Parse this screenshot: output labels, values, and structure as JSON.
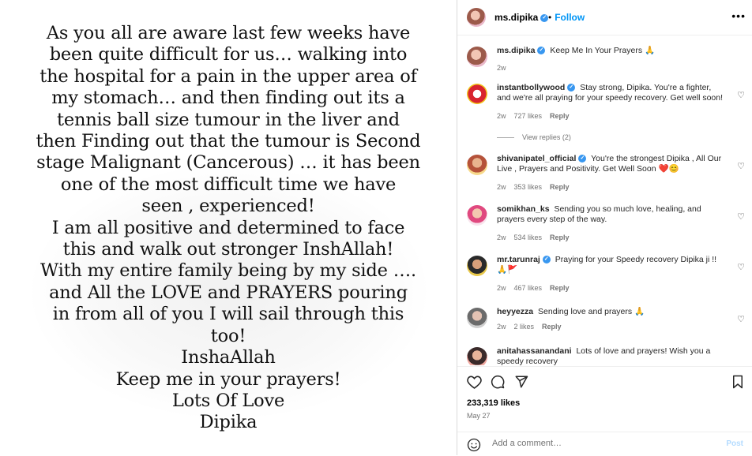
{
  "post": {
    "image_text": "As you all are aware last few weeks have\nbeen quite difficult for us… walking into\nthe hospital for a pain in the upper area of\nmy stomach… and then finding out its a\ntennis ball size tumour in the liver and\nthen Finding out that the tumour is Second\nstage Malignant (Cancerous) … it has been\none of the most difficult time we have\nseen , experienced!\nI am all positive and determined to face\nthis and walk out stronger InshAllah!\nWith my entire family being by my side ….\nand All the LOVE and PRAYERS pouring\nin from all of you I will sail through this\ntoo!\nInshaAllah\nKeep me in your prayers!\nLots Of Love\nDipika"
  },
  "header": {
    "username": "ms.dipika",
    "follow_label": "Follow",
    "separator": "•",
    "more_icon": "more-horizontal-icon"
  },
  "caption": {
    "username": "ms.dipika",
    "text": "Keep Me In Your Prayers 🙏",
    "time": "2w"
  },
  "comments": [
    {
      "username": "instantbollywood",
      "text": "Stay strong, Dipika. You're a fighter, and we're all praying for your speedy recovery. Get well soon!",
      "time": "2w",
      "likes": "727 likes",
      "reply": "Reply",
      "view_replies": "View replies (2)"
    },
    {
      "username": "shivanipatel_official",
      "text": "You're the strongest Dipika , All Our Live , Prayers and Positivity. Get Well Soon ❤️😊",
      "time": "2w",
      "likes": "353 likes",
      "reply": "Reply"
    },
    {
      "username": "somikhan_ks",
      "text": "Sending you so much love, healing, and prayers every step of the way.",
      "time": "2w",
      "likes": "534 likes",
      "reply": "Reply"
    },
    {
      "username": "mr.tarunraj",
      "text": "Praying for your Speedy recovery Dipika ji !! 🙏🚩",
      "time": "2w",
      "likes": "467 likes",
      "reply": "Reply"
    },
    {
      "username": "heyyezza",
      "text": "Sending love and prayers 🙏",
      "time": "2w",
      "likes": "2 likes",
      "reply": "Reply"
    },
    {
      "username": "anitahassanandani",
      "text": "Lots of love and prayers! Wish you a speedy recovery",
      "time": "",
      "likes": "",
      "reply": ""
    }
  ],
  "footer": {
    "likes": "233,319 likes",
    "date": "May 27",
    "comment_placeholder": "Add a comment…",
    "post_label": "Post"
  },
  "colors": {
    "accent": "#0095f6",
    "verified": "#3897f0",
    "muted": "#737373"
  }
}
